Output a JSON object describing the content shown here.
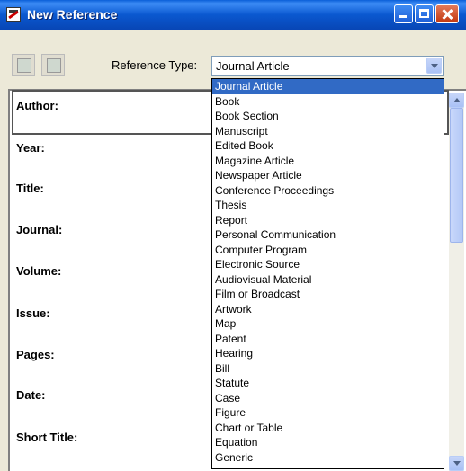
{
  "window": {
    "title": "New Reference"
  },
  "toolbar": {
    "reference_type_label": "Reference Type:",
    "selected_type": "Journal Article"
  },
  "fields": [
    {
      "label": "Author:"
    },
    {
      "label": "Year:"
    },
    {
      "label": "Title:"
    },
    {
      "label": "Journal:"
    },
    {
      "label": "Volume:"
    },
    {
      "label": "Issue:"
    },
    {
      "label": "Pages:"
    },
    {
      "label": "Date:"
    },
    {
      "label": "Short Title:"
    }
  ],
  "dropdown": {
    "selected_index": 0,
    "options": [
      "Journal Article",
      "Book",
      "Book Section",
      "Manuscript",
      "Edited Book",
      "Magazine Article",
      "Newspaper Article",
      "Conference Proceedings",
      "Thesis",
      "Report",
      "Personal Communication",
      "Computer Program",
      "Electronic Source",
      "Audiovisual Material",
      "Film or Broadcast",
      "Artwork",
      "Map",
      "Patent",
      "Hearing",
      "Bill",
      "Statute",
      "Case",
      "Figure",
      "Chart or Table",
      "Equation",
      "Generic"
    ]
  },
  "colors": {
    "titlebar": "#0a58d0",
    "selection": "#316ac5",
    "window_bg": "#ece9d8"
  },
  "icons": [
    "app-icon",
    "minimize-icon",
    "maximize-icon",
    "close-icon",
    "toolbar-icon-a",
    "toolbar-icon-b",
    "dropdown-arrow-icon",
    "scroll-up-icon",
    "scroll-down-icon"
  ]
}
